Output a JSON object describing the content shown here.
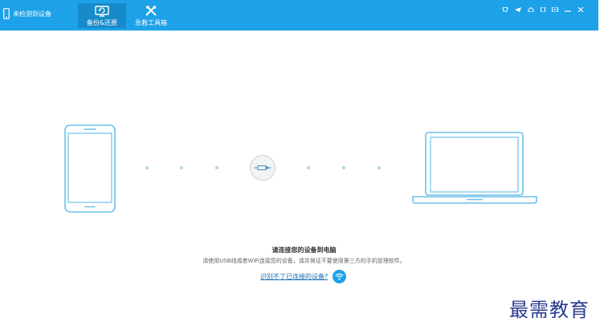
{
  "header": {
    "device_status": "未检测到设备",
    "tabs": [
      {
        "label": "备份&还原",
        "icon": "monitor-restore-icon",
        "active": true
      },
      {
        "label": "急救工具箱",
        "icon": "tools-icon",
        "active": false
      }
    ],
    "window_controls": [
      "skin-icon",
      "feedback-icon",
      "home-icon",
      "info-icon",
      "menu-icon",
      "minimize-icon",
      "close-icon"
    ]
  },
  "main": {
    "title": "请连接您的设备到电脑",
    "subtitle": "请使用USB线或者WiFi连接您的设备，请并保证不要使用第三方的手机管理软件。",
    "help_link": "识别不了已连接的设备?",
    "help_icon": "wifi-icon"
  },
  "watermark": "最需教育",
  "colors": {
    "accent": "#1da1e8",
    "active_tab": "#178bc9",
    "device_outline": "#6ec1ea",
    "dots": "#a9d6f0",
    "watermark": "#2a3d8f"
  }
}
